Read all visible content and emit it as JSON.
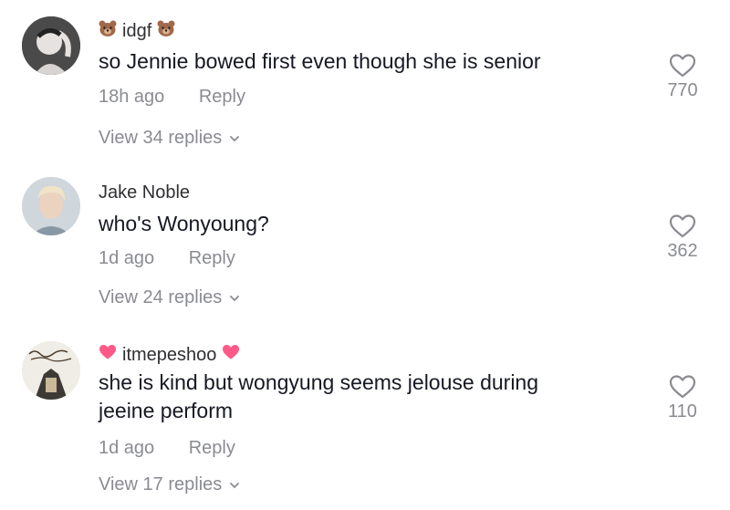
{
  "comments": [
    {
      "username": "idgf",
      "text": "so Jennie bowed first even though she is senior",
      "time": "18h ago",
      "reply": "Reply",
      "view_replies": "View 34 replies",
      "likes": "770",
      "avatar_icon": "profile-photo",
      "badge_icon": "bear-emoji"
    },
    {
      "username": "Jake Noble",
      "text": "who's Wonyoung?",
      "time": "1d ago",
      "reply": "Reply",
      "view_replies": "View 24 replies",
      "likes": "362",
      "avatar_icon": "profile-photo"
    },
    {
      "username": "itmepeshoo",
      "text_line1": "she is kind but wongyung seems jelouse during",
      "text_line2": "jeeine perform",
      "time": "1d ago",
      "reply": "Reply",
      "view_replies": "View 17 replies",
      "likes": "110",
      "avatar_icon": "arabic-calligraphy-photo",
      "badge_icon": "pink-heart-emoji"
    }
  ],
  "colors": {
    "primary_text": "#161823",
    "secondary_text": "#8a8b91",
    "heart_pink": "#ff5a87"
  }
}
